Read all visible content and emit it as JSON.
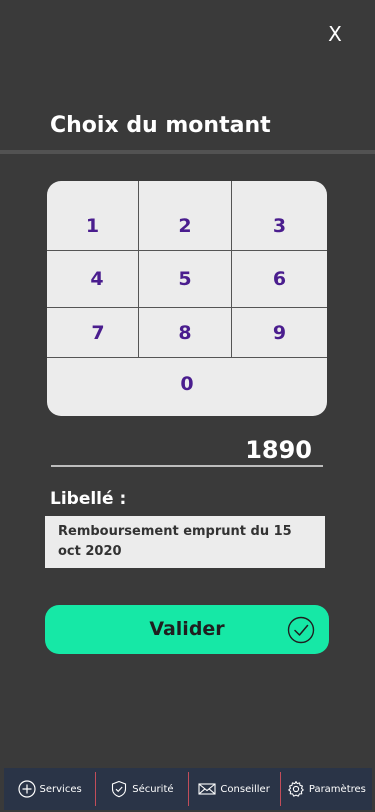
{
  "header": {
    "close_label": "X",
    "title": "Choix du montant"
  },
  "keypad": {
    "keys": [
      "1",
      "2",
      "3",
      "4",
      "5",
      "6",
      "7",
      "8",
      "9",
      "0"
    ]
  },
  "amount": {
    "value": "1890"
  },
  "libelle": {
    "label": "Libellé :",
    "value": "Remboursement emprunt du 15 oct 2020"
  },
  "validate": {
    "label": "Valider",
    "icon": "check-circle-icon"
  },
  "nav": {
    "items": [
      {
        "label": "Services",
        "icon": "plus-circle-icon"
      },
      {
        "label": "Sécurité",
        "icon": "shield-check-icon"
      },
      {
        "label": "Conseiller",
        "icon": "envelope-icon"
      },
      {
        "label": "Paramètres",
        "icon": "gear-icon"
      }
    ]
  },
  "colors": {
    "background": "#3a3a3a",
    "accent": "#16e8a6",
    "keypad_digits": "#4a1d8e",
    "nav_background": "#2a3447"
  }
}
